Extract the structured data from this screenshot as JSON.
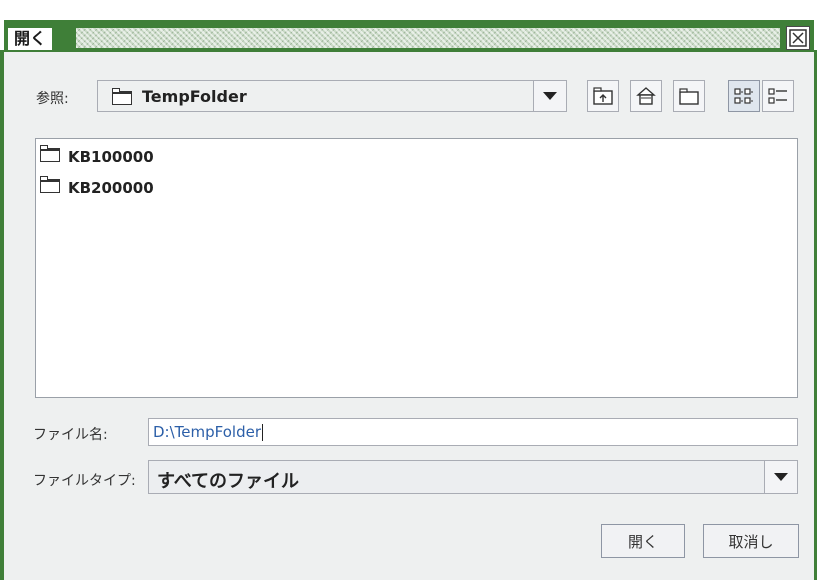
{
  "dialog": {
    "title": "開く",
    "close_icon": "close-box-icon"
  },
  "lookin": {
    "label": "参照:",
    "folder": "TempFolder"
  },
  "toolbar": {
    "buttons": [
      {
        "name": "up-one-level",
        "icon": "up-folder-icon"
      },
      {
        "name": "home",
        "icon": "home-icon"
      },
      {
        "name": "new-folder",
        "icon": "new-folder-icon"
      },
      {
        "name": "list-view",
        "icon": "list-view-icon",
        "active": true
      },
      {
        "name": "details-view",
        "icon": "details-view-icon"
      }
    ]
  },
  "files": [
    {
      "name": "KB100000"
    },
    {
      "name": "KB200000"
    }
  ],
  "filename": {
    "label": "ファイル名:",
    "value": "D:\\TempFolder"
  },
  "filetype": {
    "label": "ファイルタイプ:",
    "value": "すべてのファイル"
  },
  "actions": {
    "open_label": "開く",
    "cancel_label": "取消し"
  },
  "colors": {
    "title_band": "#3f7f38",
    "background": "#eef0f0",
    "text_selection": "#2c5fa8"
  }
}
